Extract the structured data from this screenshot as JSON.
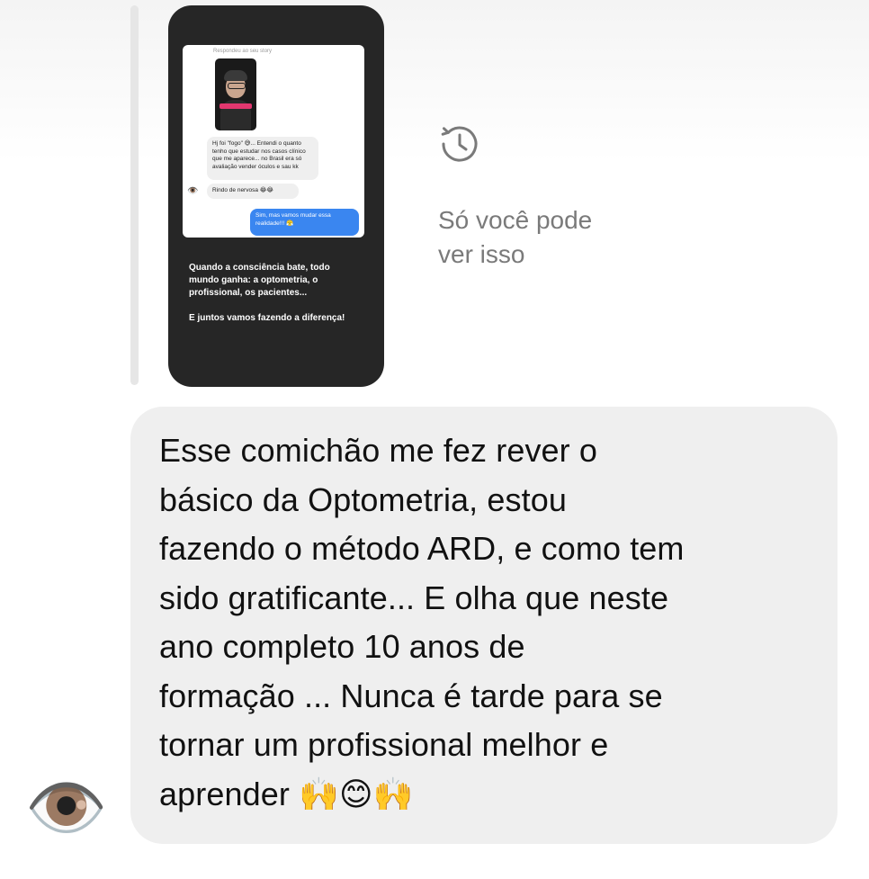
{
  "story_reply": {
    "inner_reply_label": "Respondeu ao seu story",
    "inner_messages": [
      {
        "text": "Hj foi \"fogo\" 😅... Entendi o quanto tenho que estudar nos casos clínico que me aparece... no Brasil era só avaliação vender óculos e sau kk",
        "from": "other"
      },
      {
        "text": "Rindo de nervosa 😂😂",
        "from": "other"
      },
      {
        "text": "Sim, mas vamos mudar essa realidade!!! 😤",
        "from": "me"
      }
    ],
    "inner_avatar_emoji": "👁️",
    "caption_lines": [
      "Quando a consciência bate,  todo",
      "mundo ganha: a optometria, o",
      "profissional, os pacientes...",
      "",
      "E juntos vamos fazendo a diferença!"
    ]
  },
  "visibility": {
    "icon": "history-clock-icon",
    "text_lines": [
      "Só você pode",
      "ver isso"
    ]
  },
  "message": {
    "lines": [
      "Esse comichão me fez rever o",
      "básico da Optometria, estou",
      "fazendo o método ARD, e como tem",
      "sido gratificante... E olha que neste",
      "ano completo 10 anos de",
      "formação ... Nunca é tarde para se",
      "tornar um profissional melhor e",
      "aprender"
    ],
    "emojis": "🙌😊🙌"
  },
  "sender": {
    "avatar_emoji": "👁️"
  },
  "colors": {
    "bubble": "#efefef",
    "story_bg": "#262626",
    "my_bubble": "#3a86f0",
    "muted_text": "#7a7a7a"
  }
}
